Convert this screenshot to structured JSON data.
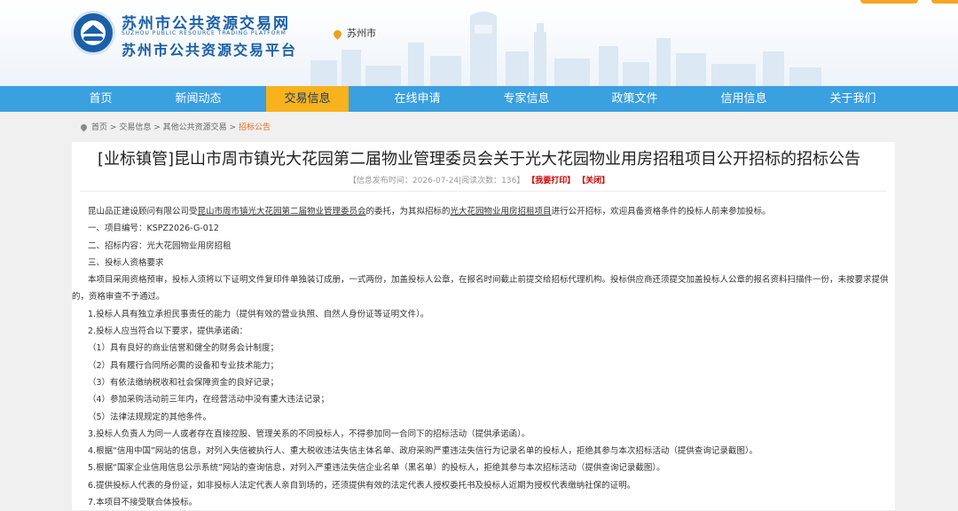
{
  "header": {
    "site_title": "苏州市公共资源交易网",
    "site_title_en": "SUZHOU PUBLIC RESOURCE TRADING PLATFORM",
    "site_subtitle": "苏州市公共资源交易平台",
    "location": "苏州市"
  },
  "nav": {
    "items": [
      {
        "label": "首页"
      },
      {
        "label": "新闻动态"
      },
      {
        "label": "交易信息"
      },
      {
        "label": "在线申请"
      },
      {
        "label": "专家信息"
      },
      {
        "label": "政策文件"
      },
      {
        "label": "信用信息"
      },
      {
        "label": "关于我们"
      }
    ],
    "active_index": 2
  },
  "breadcrumb": {
    "items": [
      "首页",
      "交易信息",
      "其他公共资源交易",
      "招标公告"
    ],
    "separator": ">"
  },
  "article": {
    "title": "[业标镇管]昆山市周市镇光大花园第二届物业管理委员会关于光大花园物业用房招租项目公开招标的招标公告",
    "meta_publish": "【信息发布时间：2026-07-24|阅读次数：136】",
    "meta_print": "【我要打印】",
    "meta_close": "【关闭】",
    "intro_pre": "昆山品正建设顾问有限公司受",
    "intro_org": "昆山市周市镇光大花园第二届物业管理委员会",
    "intro_mid": "的委托，为其拟招标的",
    "intro_project": "光大花园物业用房招租项目",
    "intro_post": "进行公开招标，欢迎具备资格条件的投标人前来参加投标。",
    "lines": [
      "一、项目编号：KSPZ2026-G-012",
      "二、招标内容：光大花园物业用房招租",
      "三、投标人资格要求"
    ],
    "para_prequal": "本项目采用资格预审，投标人须将以下证明文件复印件单独装订成册，一式两份，加盖投标人公章，在报名时间截止前提交给招标代理机构。投标供应商还须提交加盖投标人公章的报名资料扫描件一份，未按要求提供的，资格审查不予通过。",
    "reqs": [
      "1.投标人具有独立承担民事责任的能力（提供有效的营业执照、自然人身份证等证明文件）。",
      "2.投标人应当符合以下要求，提供承诺函：",
      "（1）具有良好的商业信誉和健全的财务会计制度；",
      "（2）具有履行合同所必需的设备和专业技术能力；",
      "（3）有依法缴纳税收和社会保障资金的良好记录；",
      "（4）参加采购活动前三年内，在经营活动中没有重大违法记录；",
      "（5）法律法规规定的其他条件。",
      "3.投标人负责人为同一人或者存在直接控股、管理关系的不同投标人，不得参加同一合同下的招标活动（提供承诺函）。",
      "4.根据“信用中国”网站的信息，对列入失信被执行人、重大税收违法失信主体名单、政府采购严重违法失信行为记录名单的投标人，拒绝其参与本次招标活动（提供查询记录截图）。",
      "5.根据“国家企业信用信息公示系统”网站的查询信息，对列入严重违法失信企业名单（黑名单）的投标人，拒绝其参与本次招标活动（提供查询记录截图）。",
      "6.提供投标人代表的身份证，如非投标人法定代表人亲自到场的，还须提供有效的法定代表人授权委托书及投标人近期为授权代表缴纳社保的证明。",
      "7.本项目不接受联合体投标。"
    ]
  },
  "colors": {
    "brand_blue": "#1a5fa8",
    "nav_blue": "#3aa0e0",
    "nav_active": "#f7b21c",
    "crumb_current": "#e07020"
  }
}
